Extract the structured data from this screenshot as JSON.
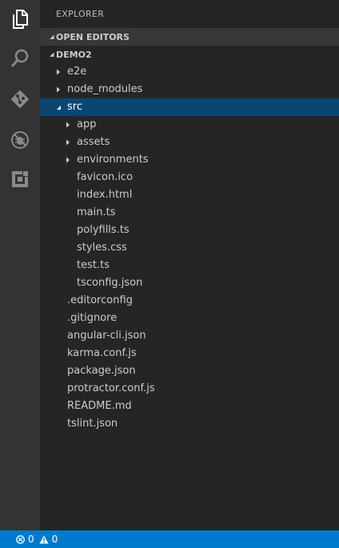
{
  "activity_bar": {
    "items": [
      {
        "icon": "files-icon",
        "active": true
      },
      {
        "icon": "search-icon",
        "active": false
      },
      {
        "icon": "git-icon",
        "active": false
      },
      {
        "icon": "debug-icon",
        "active": false
      },
      {
        "icon": "extensions-icon",
        "active": false
      }
    ]
  },
  "explorer": {
    "title": "EXPLORER",
    "open_editors": {
      "label": "OPEN EDITORS",
      "expanded": true
    },
    "project": {
      "label": "DEMO2",
      "expanded": true
    },
    "tree": [
      {
        "name": "e2e",
        "kind": "folder",
        "expanded": false,
        "depth": 1
      },
      {
        "name": "node_modules",
        "kind": "folder",
        "expanded": false,
        "depth": 1
      },
      {
        "name": "src",
        "kind": "folder",
        "expanded": true,
        "depth": 1,
        "selected": true
      },
      {
        "name": "app",
        "kind": "folder",
        "expanded": false,
        "depth": 2
      },
      {
        "name": "assets",
        "kind": "folder",
        "expanded": false,
        "depth": 2
      },
      {
        "name": "environments",
        "kind": "folder",
        "expanded": false,
        "depth": 2
      },
      {
        "name": "favicon.ico",
        "kind": "file",
        "depth": 2
      },
      {
        "name": "index.html",
        "kind": "file",
        "depth": 2
      },
      {
        "name": "main.ts",
        "kind": "file",
        "depth": 2
      },
      {
        "name": "polyfills.ts",
        "kind": "file",
        "depth": 2
      },
      {
        "name": "styles.css",
        "kind": "file",
        "depth": 2
      },
      {
        "name": "test.ts",
        "kind": "file",
        "depth": 2
      },
      {
        "name": "tsconfig.json",
        "kind": "file",
        "depth": 2
      },
      {
        "name": ".editorconfig",
        "kind": "file",
        "depth": 1
      },
      {
        "name": ".gitignore",
        "kind": "file",
        "depth": 1
      },
      {
        "name": "angular-cli.json",
        "kind": "file",
        "depth": 1
      },
      {
        "name": "karma.conf.js",
        "kind": "file",
        "depth": 1
      },
      {
        "name": "package.json",
        "kind": "file",
        "depth": 1
      },
      {
        "name": "protractor.conf.js",
        "kind": "file",
        "depth": 1
      },
      {
        "name": "README.md",
        "kind": "file",
        "depth": 1
      },
      {
        "name": "tslint.json",
        "kind": "file",
        "depth": 1
      }
    ]
  },
  "status_bar": {
    "errors": "0",
    "warnings": "0"
  },
  "colors": {
    "activity_bar": "#333333",
    "sidebar": "#252526",
    "selection": "#094771",
    "status_bar": "#007acc"
  }
}
